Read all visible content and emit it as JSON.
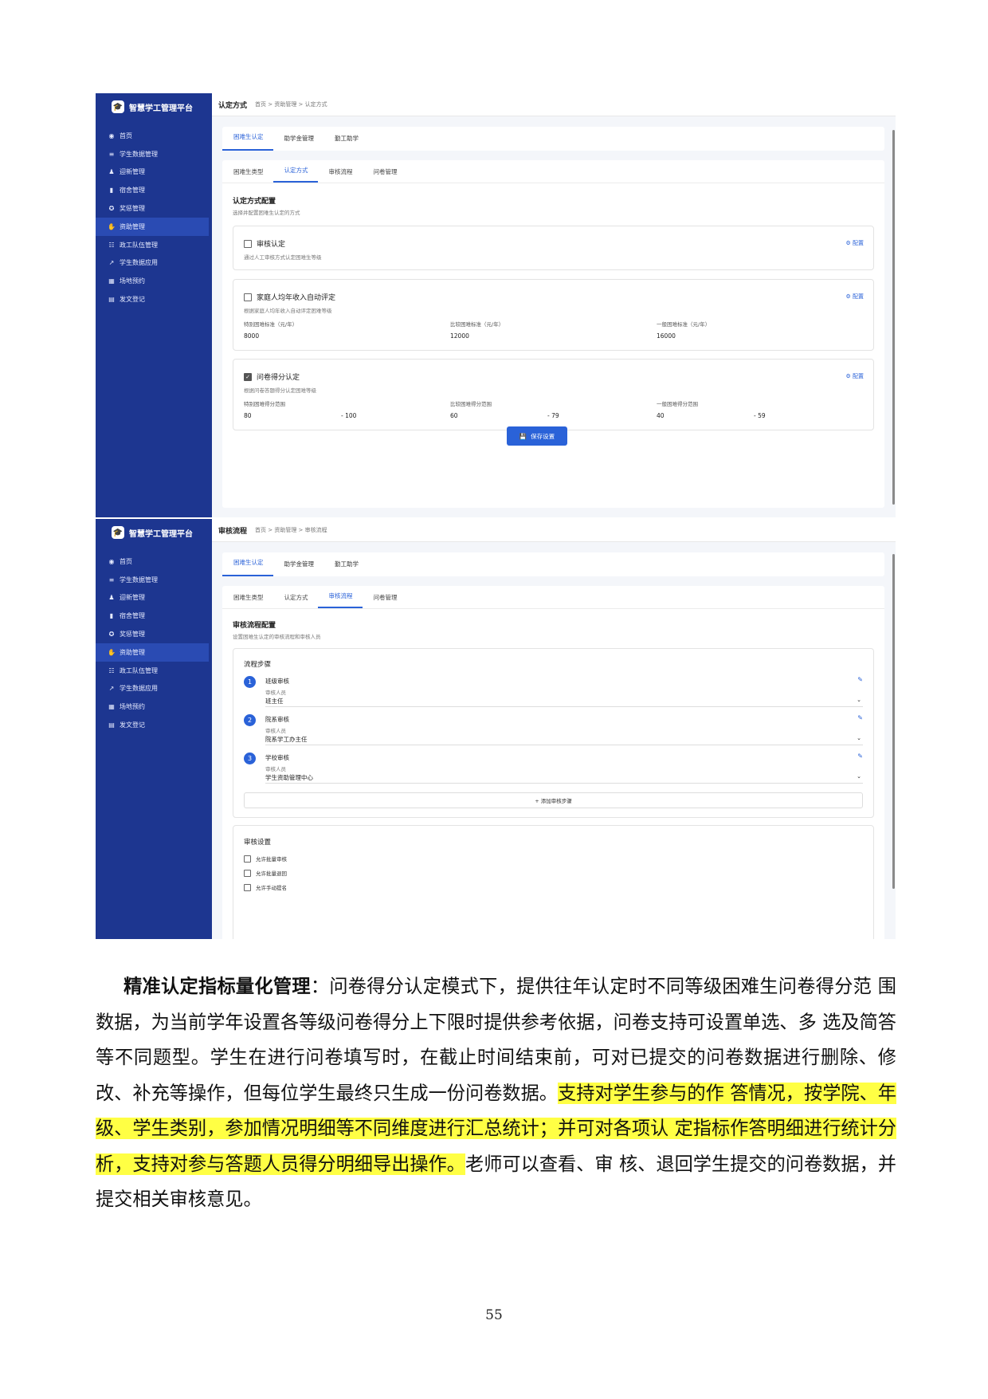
{
  "brand": "智慧学工管理平台",
  "menu": [
    "首页",
    "学生数据管理",
    "迎新管理",
    "宿舍管理",
    "奖惩管理",
    "资助管理",
    "政工队伍管理",
    "学生数据应用",
    "场地预约",
    "发文登记"
  ],
  "top_tabs": [
    "困难生认定",
    "助学金管理",
    "勤工助学"
  ],
  "sub_tabs": [
    "困难生类型",
    "认定方式",
    "审核流程",
    "问卷管理"
  ],
  "shot1": {
    "page_title": "认定方式",
    "breadcrumb": "首页 > 资助管理 > 认定方式",
    "section_title": "认定方式配置",
    "section_desc": "选择并配置困难生认定的方式",
    "config_label": "⚙ 配置",
    "cards": [
      {
        "title": "审核认定",
        "desc": "通过人工审核方式认定困难生等级",
        "checked": false
      },
      {
        "title": "家庭人均年收入自动评定",
        "desc": "根据家庭人均年收入自动评定困难等级",
        "checked": false,
        "fields": [
          {
            "label": "特别困难标准（元/年）",
            "value": "8000"
          },
          {
            "label": "比较困难标准（元/年）",
            "value": "12000"
          },
          {
            "label": "一般困难标准（元/年）",
            "value": "16000"
          }
        ]
      },
      {
        "title": "问卷得分认定",
        "desc": "根据问卷答题得分认定困难等级",
        "checked": true,
        "ranges": [
          {
            "label": "特别困难得分范围",
            "min": "80",
            "max": "- 100"
          },
          {
            "label": "比较困难得分范围",
            "min": "60",
            "max": "- 79"
          },
          {
            "label": "一般困难得分范围",
            "min": "40",
            "max": "- 59"
          }
        ]
      }
    ],
    "save_label": "保存设置"
  },
  "shot2": {
    "page_title": "审核流程",
    "breadcrumb": "首页 > 资助管理 > 审核流程",
    "section_title": "审核流程配置",
    "section_desc": "设置困难生认定的审核流程和审核人员",
    "steps_title": "流程步骤",
    "reviewer_label": "审核人员",
    "steps": [
      {
        "num": "1",
        "name": "班级审核",
        "reviewer": "班主任"
      },
      {
        "num": "2",
        "name": "院系审核",
        "reviewer": "院系学工办主任"
      },
      {
        "num": "3",
        "name": "学校审核",
        "reviewer": "学生资助管理中心"
      }
    ],
    "add_step": "+ 添加审核步骤",
    "settings_title": "审核设置",
    "options": [
      "允许批量审核",
      "允许批量退回",
      "允许手动提名"
    ]
  },
  "paragraph": {
    "lead": "精准认定指标量化管理",
    "part1": "：问卷得分认定模式下，提供往年认定时不同等级困难生问卷得分范 围数据，为当前学年设置各等级问卷得分上下限时提供参考依据，问卷支持可设置单选、多 选及简答等不同题型。学生在进行问卷填写时，在截止时间结束前，可对已提交的问卷数据进行删除、修改、补充等操作，但每位学生最终只生成一份问卷数据。",
    "highlight": "支持对学生参与的作 答情况，按学院、年级、学生类别，参加情况明细等不同维度进行汇总统计；并可对各项认 定指标作答明细进行统计分析，支持对参与答题人员得分明细导出操作。",
    "part2": "老师可以查看、审 核、退回学生提交的问卷数据，并提交相关审核意见。"
  },
  "page_number": "55"
}
